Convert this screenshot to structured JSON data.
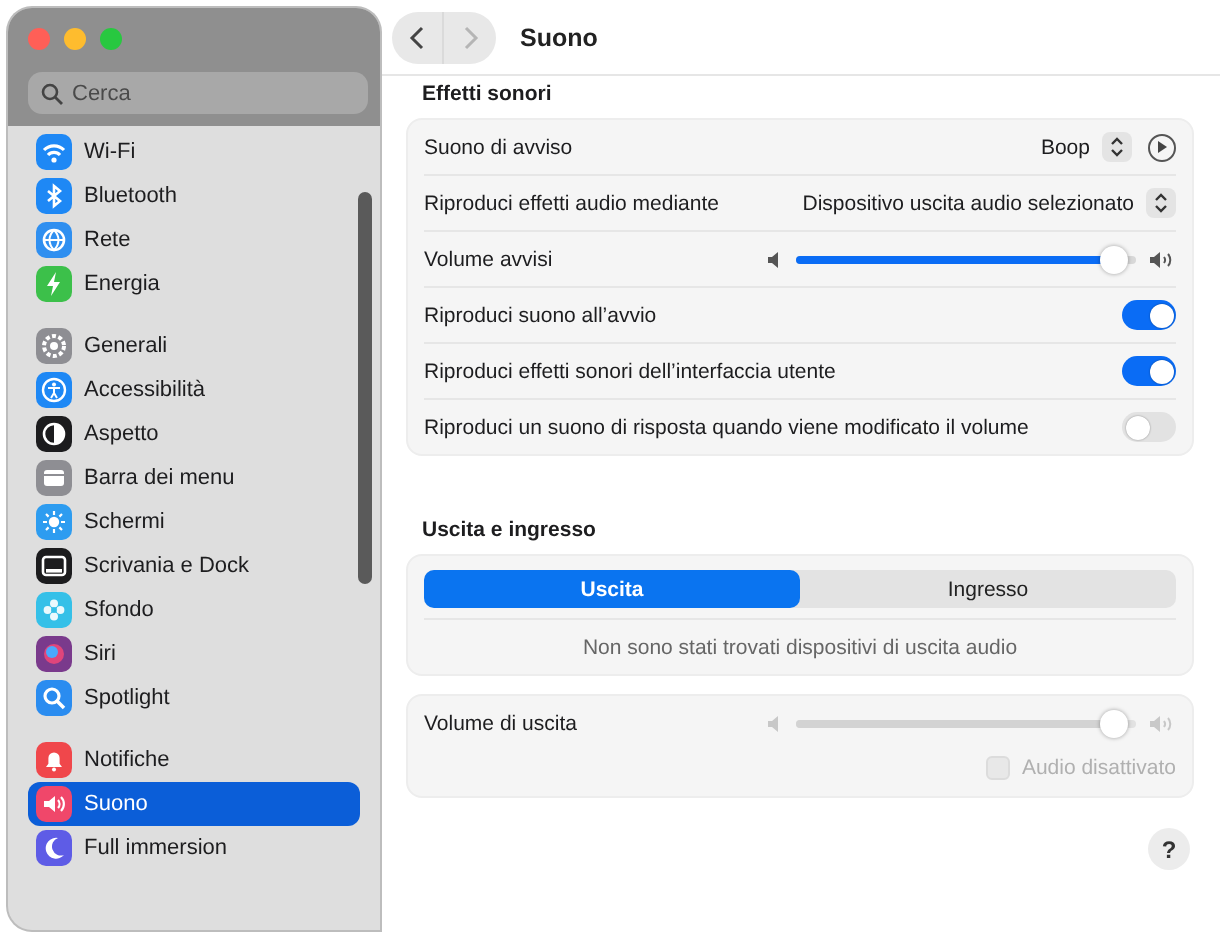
{
  "window": {
    "title": "Suono"
  },
  "navigation": [
    {
      "kind": "back",
      "disabled": false
    },
    {
      "kind": "forward",
      "disabled": true
    }
  ],
  "sidebar": {
    "search": {
      "placeholder": "Cerca"
    },
    "groups": [
      [
        {
          "label": "Wi-Fi",
          "color": "#1e88f5",
          "selected": false
        },
        {
          "label": "Bluetooth",
          "color": "#1e88f5",
          "selected": false
        },
        {
          "label": "Rete",
          "color": "#2f8ff0",
          "selected": false
        },
        {
          "label": "Energia",
          "color": "#3cc04a",
          "selected": false
        }
      ],
      [
        {
          "label": "Generali",
          "color": "#8e8e93",
          "selected": false
        },
        {
          "label": "Accessibilità",
          "color": "#1e88f5",
          "selected": false
        },
        {
          "label": "Aspetto",
          "color": "#1c1c1e",
          "selected": false
        },
        {
          "label": "Barra dei menu",
          "color": "#8e8e93",
          "selected": false
        },
        {
          "label": "Schermi",
          "color": "#2d9cf0",
          "selected": false
        },
        {
          "label": "Scrivania e Dock",
          "color": "#1c1c1e",
          "selected": false
        },
        {
          "label": "Sfondo",
          "color": "#35c0e8",
          "selected": false
        },
        {
          "label": "Siri",
          "color": "#7a3a8c",
          "selected": false
        },
        {
          "label": "Spotlight",
          "color": "#2a8cf0",
          "selected": false
        }
      ],
      [
        {
          "label": "Notifiche",
          "color": "#f0474b",
          "selected": false
        },
        {
          "label": "Suono",
          "color": "#f0476a",
          "selected": true
        },
        {
          "label": "Full immersion",
          "color": "#5e5ce6",
          "selected": false
        }
      ]
    ]
  },
  "sections": [
    {
      "title": "Effetti sonori",
      "cards": [
        {
          "rows": [
            {
              "kind": "popup",
              "label": "Suono di avviso",
              "value": "Boop",
              "play": true
            },
            {
              "kind": "popup",
              "label": "Riproduci effetti audio mediante",
              "value": "Dispositivo uscita audio selezionato"
            },
            {
              "kind": "slider",
              "label": "Volume avvisi",
              "level": 0.95,
              "disabled": false
            },
            {
              "kind": "toggle",
              "label": "Riproduci suono all’avvio",
              "on": true
            },
            {
              "kind": "toggle",
              "label": "Riproduci effetti sonori dell’interfaccia utente",
              "on": true
            },
            {
              "kind": "toggle",
              "label": "Riproduci un suono di risposta quando viene modificato il volume",
              "on": false
            }
          ]
        }
      ]
    },
    {
      "title": "Uscita e ingresso",
      "cards": [
        {
          "rows": [
            {
              "kind": "segmented",
              "tabs": [
                {
                  "label": "Uscita",
                  "selected": true
                },
                {
                  "label": "Ingresso",
                  "selected": false
                }
              ]
            },
            {
              "kind": "message",
              "text": "Non sono stati trovati dispositivi di uscita audio"
            }
          ]
        },
        {
          "rows": [
            {
              "kind": "slider",
              "label": "Volume di uscita",
              "level": 0.95,
              "disabled": true
            },
            {
              "kind": "checkbox",
              "label": "Audio disattivato",
              "checked": false,
              "disabled": true
            }
          ]
        }
      ]
    }
  ],
  "help": {
    "label": "?"
  }
}
